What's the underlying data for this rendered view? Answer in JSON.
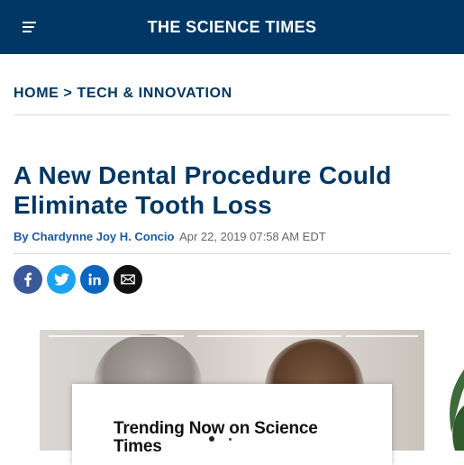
{
  "header": {
    "menu_icon": "hamburger-menu-icon",
    "logo_text": "THE SCIENCE TIMES",
    "background": "#003764"
  },
  "breadcrumb": {
    "home": "HOME",
    "separator": ">",
    "category": "TECH & INNOVATION"
  },
  "article": {
    "title": "A New Dental Procedure Could Eliminate Tooth Loss",
    "by_label": "By",
    "author": "Chardynne Joy H. Concio",
    "date": "Apr 22, 2019 07:58 AM EDT"
  },
  "share": {
    "facebook_icon": "facebook-icon",
    "twitter_icon": "twitter-icon",
    "linkedin_icon": "linkedin-icon",
    "email_icon": "email-icon"
  },
  "popup": {
    "title": "Trending Now on Science Times"
  },
  "colors": {
    "brand_navy": "#003764",
    "author_blue": "#1a5aa8",
    "facebook": "#3b5998",
    "twitter": "#1da1f2",
    "linkedin": "#0a66c2",
    "email": "#111111"
  }
}
